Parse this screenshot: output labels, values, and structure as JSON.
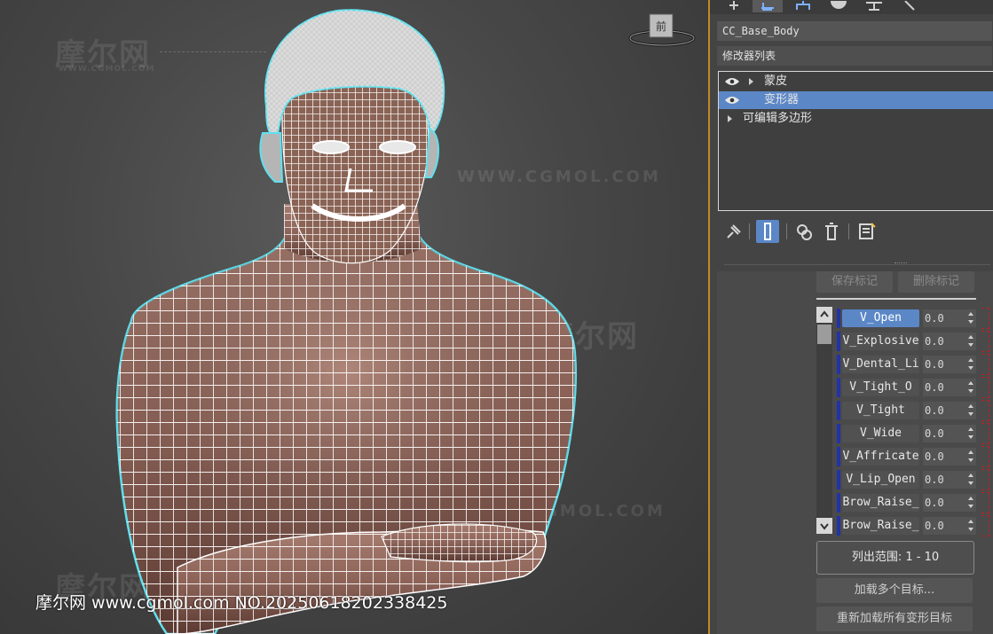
{
  "viewport": {
    "view_cube_label": "前",
    "watermarks": {
      "logo": "摩尔网",
      "url_small": "WWW.CGMOL.COM",
      "url_large": "WWW.CGMOL.COM"
    },
    "footer_watermark": "摩尔网 www.cgmol.com NO.20250618202338425"
  },
  "panel": {
    "object_name": "CC_Base_Body",
    "modifier_list_label": "修改器列表",
    "stack": [
      {
        "label": "蒙皮",
        "has_eye": true,
        "expandable": true,
        "selected": false
      },
      {
        "label": "变形器",
        "has_eye": true,
        "expandable": false,
        "selected": true
      },
      {
        "label": "可编辑多边形",
        "has_eye": false,
        "expandable": true,
        "selected": false
      }
    ],
    "toolbar_icons": [
      "pin-stack-icon",
      "show-end-result-icon",
      "make-unique-icon",
      "remove-modifier-icon",
      "configure-modifier-sets-icon"
    ],
    "morpher": {
      "save_marker": "保存标记",
      "delete_marker": "删除标记",
      "channels": [
        {
          "name": "V_Open",
          "value": "0.0",
          "active": true
        },
        {
          "name": "V_Explosive",
          "value": "0.0",
          "active": false
        },
        {
          "name": "V_Dental_Li",
          "value": "0.0",
          "active": false
        },
        {
          "name": "V_Tight_O",
          "value": "0.0",
          "active": false
        },
        {
          "name": "V_Tight",
          "value": "0.0",
          "active": false
        },
        {
          "name": "V_Wide",
          "value": "0.0",
          "active": false
        },
        {
          "name": "V_Affricate",
          "value": "0.0",
          "active": false
        },
        {
          "name": "V_Lip_Open",
          "value": "0.0",
          "active": false
        },
        {
          "name": "Brow_Raise_",
          "value": "0.0",
          "active": false
        },
        {
          "name": "Brow_Raise_",
          "value": "0.0",
          "active": false
        }
      ],
      "list_range": "列出范围: 1 - 10",
      "load_multiple": "加载多个目标...",
      "reload_all": "重新加载所有变形目标"
    }
  },
  "colors": {
    "selection_blue": "#5b87c7",
    "viewport_border": "#c08a25",
    "channel_bar": "#2233a8",
    "selection_outline": "#5fe0ee"
  }
}
